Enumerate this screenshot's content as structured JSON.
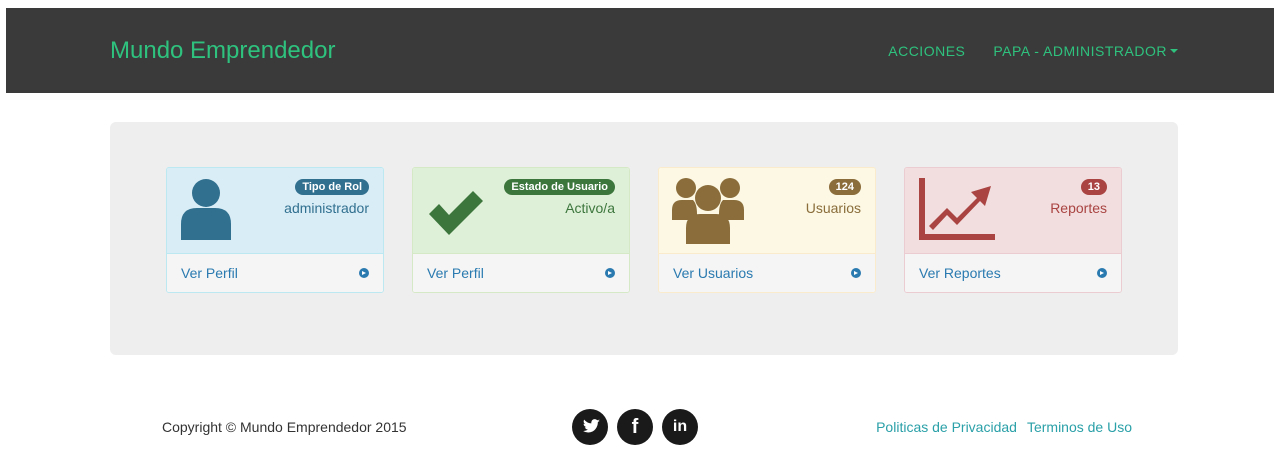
{
  "navbar": {
    "brand": "Mundo Emprendedor",
    "links": [
      {
        "label": "ACCIONES"
      },
      {
        "label": "PAPA - ADMINISTRADOR"
      }
    ],
    "accent": "#2ec27e",
    "background": "#3a3a3a"
  },
  "panels": [
    {
      "badge": "Tipo de Rol",
      "text": "administrador",
      "link": "Ver Perfil",
      "icon": "user-icon",
      "color": "#31708f"
    },
    {
      "badge": "Estado de Usuario",
      "text": "Activo/a",
      "link": "Ver Perfil",
      "icon": "check-icon",
      "color": "#3c763d"
    },
    {
      "badge": "124",
      "text": "Usuarios",
      "link": "Ver Usuarios",
      "icon": "users-icon",
      "color": "#8a6d3b"
    },
    {
      "badge": "13",
      "text": "Reportes",
      "link": "Ver Reportes",
      "icon": "line-chart-icon",
      "color": "#a94442"
    }
  ],
  "footer": {
    "copyright": "Copyright © Mundo Emprendedor 2015",
    "socials": [
      {
        "icon": "twitter-icon"
      },
      {
        "icon": "facebook-icon",
        "glyph": "f"
      },
      {
        "icon": "linkedin-icon",
        "glyph": "in"
      }
    ],
    "links": [
      {
        "label": "Politicas de Privacidad"
      },
      {
        "label": "Terminos de Uso"
      }
    ]
  }
}
